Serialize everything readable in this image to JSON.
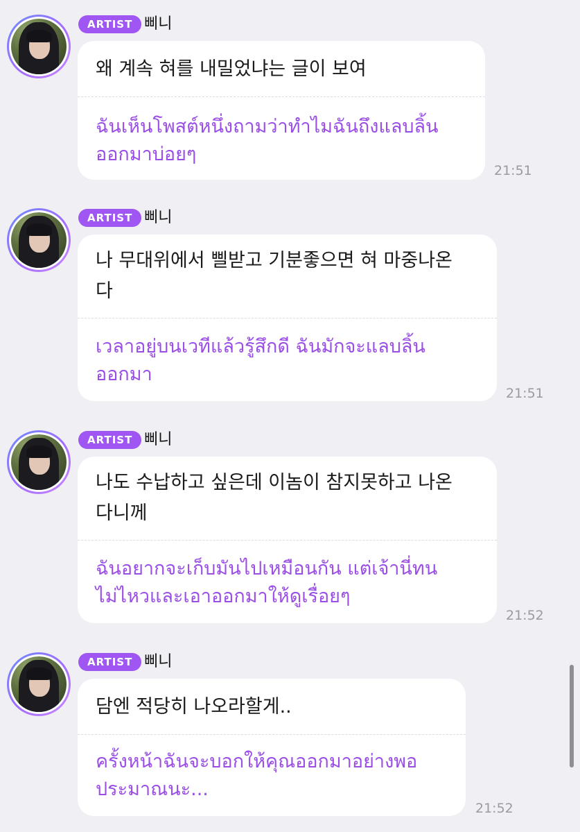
{
  "messages": [
    {
      "badge": "ARTIST",
      "name": "삐니",
      "korean": "왜 계속 혀를 내밀었냐는 글이 보여",
      "thai": "ฉันเห็นโพสต์หนึ่งถามว่าทำไมฉันถึงแลบลิ้น\nออกมาบ่อยๆ",
      "time": "21:51"
    },
    {
      "badge": "ARTIST",
      "name": "삐니",
      "korean": "나 무대위에서 삘받고 기분좋으면 혀 마중나온\n다",
      "thai": "เวลาอยู่บนเวทีแล้วรู้สึกดี ฉันมักจะแลบลิ้น\nออกมา",
      "time": "21:51"
    },
    {
      "badge": "ARTIST",
      "name": "삐니",
      "korean": "나도 수납하고 싶은데 이놈이 참지못하고 나온\n다니께",
      "thai": "ฉันอยากจะเก็บมันไปเหมือนกัน แต่เจ้านี่ทน\nไม่ไหวและเอาออกมาให้ดูเรื่อยๆ",
      "time": "21:52"
    },
    {
      "badge": "ARTIST",
      "name": "삐니",
      "korean": "담엔 적당히 나오라할게..",
      "thai": "ครั้งหน้าฉันจะบอกให้คุณออกมาอย่างพอ\nประมาณนะ...",
      "time": "21:52"
    }
  ]
}
